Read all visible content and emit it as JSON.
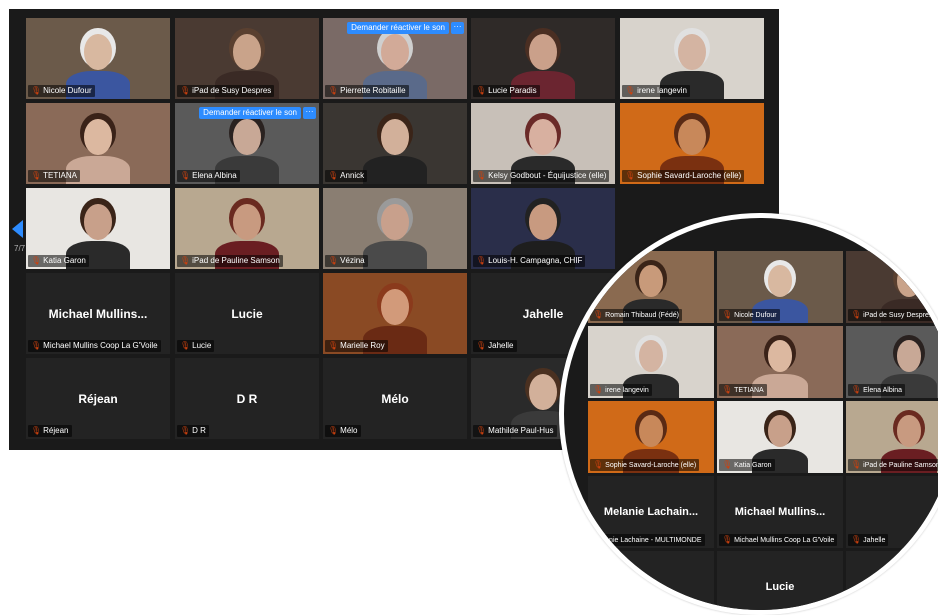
{
  "gallery": {
    "page_indicator": "7/7",
    "unmute_label": "Demander réactiver le son",
    "more_label": "···",
    "tiles": [
      {
        "name": "Nicole Dufour",
        "bg": "#6b5a4a",
        "skin": "#d8b8a0",
        "hair": "#e8e8e8",
        "shirt": "#3b56a0"
      },
      {
        "name": "iPad de Susy Despres",
        "bg": "#4a3a32",
        "skin": "#c9a38a",
        "hair": "#5a4030",
        "shirt": "#3a2a25"
      },
      {
        "name": "Pierrette Robitaille",
        "bg": "#7a6a66",
        "skin": "#d2aa98",
        "hair": "#cfcfcf",
        "shirt": "#5a6a8a"
      },
      {
        "name": "Lucie Paradis",
        "bg": "#2f2a28",
        "skin": "#caa08a",
        "hair": "#4a2e22",
        "shirt": "#6b2530"
      },
      {
        "name": "irene langevin",
        "bg": "#d8d3cc",
        "skin": "#d4b4a2",
        "hair": "#e0e0e0",
        "shirt": "#2a2a2a"
      },
      {
        "name": "TETIANA",
        "bg": "#8a6a58",
        "skin": "#dcb8a0",
        "hair": "#3a2218",
        "shirt": "#caa896"
      },
      {
        "name": "Elena Albina",
        "bg": "#5a5a5a",
        "skin": "#c8a896",
        "hair": "#2a2220",
        "shirt": "#3a3a3a"
      },
      {
        "name": "Annick",
        "bg": "#3a3632",
        "skin": "#d2b09a",
        "hair": "#3a2418",
        "shirt": "#222222"
      },
      {
        "name": "Kelsy Godbout - Équijustice (elle)",
        "bg": "#c8c0b8",
        "skin": "#d8b0a0",
        "hair": "#6a2a28",
        "shirt": "#2a2a2a"
      },
      {
        "name": "Sophie Savard-Laroche (elle)",
        "bg": "#d06a18",
        "skin": "#c8885a",
        "hair": "#5a2a14",
        "shirt": "#7a3010"
      },
      {
        "name": "Katia Garon",
        "bg": "#e8e6e2",
        "skin": "#c8a08a",
        "hair": "#3a2418",
        "shirt": "#2a2a2a"
      },
      {
        "name": "iPad de Pauline Samson",
        "bg": "#b8a890",
        "skin": "#c89a80",
        "hair": "#6a2a20",
        "shirt": "#6a1e22"
      },
      {
        "name": "Vézina",
        "bg": "#8a7e72",
        "skin": "#c8a08c",
        "hair": "#9a9a9a",
        "shirt": "#4a4a4a"
      },
      {
        "name": "Louis-H. Campagna, CHIF",
        "bg": "#2a2e4a",
        "skin": "#c89a80",
        "hair": "#222222",
        "shirt": "#1e1e1e"
      },
      {
        "name": "Melanie",
        "name_only": true
      },
      {
        "name": "Michael Mullins Coop La G'Voile",
        "big": "Michael Mullins...",
        "name_only": true
      },
      {
        "name": "Lucie",
        "big": "Lucie",
        "name_only": true
      },
      {
        "name": "Marielle Roy",
        "bg": "#8a4a24",
        "skin": "#d29a7a",
        "hair": "#8a3a1c",
        "shirt": "#6a2a14"
      },
      {
        "name": "Jahelle",
        "big": "Jahelle",
        "name_only": true
      },
      {
        "name": "",
        "name_only": true
      },
      {
        "name": "Réjean",
        "big": "Réjean",
        "name_only": true
      },
      {
        "name": "D R",
        "big": "D R",
        "name_only": true
      },
      {
        "name": "Mélo",
        "big": "Mélo",
        "name_only": true
      },
      {
        "name": "Mathilde Paul-Hus",
        "bg": "#2a2a2a",
        "skin": "#d2b09a",
        "hair": "#4a3020",
        "shirt": "#3a3a3a"
      },
      {
        "name": "",
        "name_only": true
      }
    ]
  },
  "zoom_circle": {
    "tiles": [
      {
        "name": "Romain Thibaud (Fédé)",
        "bg": "#8a6a50",
        "skin": "#c89a7a",
        "hair": "#3a2418",
        "shirt": "#2a2a2a",
        "active": true
      },
      {
        "name": "Nicole Dufour",
        "bg": "#6b5a4a",
        "skin": "#d8b8a0",
        "hair": "#e8e8e8",
        "shirt": "#3b56a0"
      },
      {
        "name": "iPad de Susy Despres",
        "bg": "#4a3a32",
        "skin": "#c9a38a",
        "hair": "#5a4030",
        "shirt": "#3a2a25"
      },
      {
        "name": "irene langevin",
        "bg": "#d8d3cc",
        "skin": "#d4b4a2",
        "hair": "#e0e0e0",
        "shirt": "#2a2a2a"
      },
      {
        "name": "TETIANA",
        "bg": "#8a6a58",
        "skin": "#dcb8a0",
        "hair": "#3a2218",
        "shirt": "#caa896"
      },
      {
        "name": "Elena Albina",
        "bg": "#5a5a5a",
        "skin": "#c8a896",
        "hair": "#2a2220",
        "shirt": "#3a3a3a"
      },
      {
        "name": "Sophie Savard-Laroche (elle)",
        "bg": "#d06a18",
        "skin": "#c8885a",
        "hair": "#5a2a14",
        "shirt": "#7a3010"
      },
      {
        "name": "Katia Garon",
        "bg": "#e8e6e2",
        "skin": "#c8a08a",
        "hair": "#3a2418",
        "shirt": "#2a2a2a"
      },
      {
        "name": "iPad de Pauline Samson",
        "bg": "#b8a890",
        "skin": "#c89a80",
        "hair": "#6a2a20",
        "shirt": "#6a1e22"
      },
      {
        "name": "anie Lachaine - MULTIMONDE",
        "big": "Melanie  Lachain...",
        "name_only": true
      },
      {
        "name": "Michael Mullins Coop La G'Voile",
        "big": "Michael  Mullins...",
        "name_only": true
      },
      {
        "name": "Jahelle",
        "big": "Jahe",
        "name_only": true
      },
      {
        "name": "",
        "big": "",
        "name_only": true
      },
      {
        "name": "",
        "big": "Lucie",
        "name_only": true
      },
      {
        "name": "",
        "big": "",
        "name_only": true
      }
    ]
  }
}
